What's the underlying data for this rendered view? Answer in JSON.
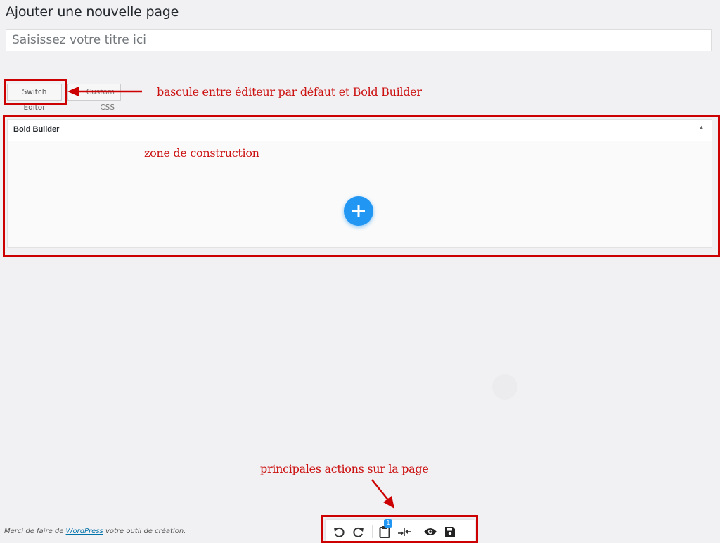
{
  "page": {
    "heading": "Ajouter une nouvelle page",
    "title_placeholder": "Saisissez votre titre ici"
  },
  "buttons": {
    "switch_editor": "Switch Editor",
    "custom_css": "Custom CSS"
  },
  "builder": {
    "title": "Bold Builder",
    "toggle_glyph": "▲"
  },
  "toolbar": {
    "clipboard_count": "1",
    "icons": [
      "undo-icon",
      "redo-icon",
      "clipboard-icon",
      "split-arrows-icon",
      "preview-eye-icon",
      "save-icon"
    ]
  },
  "footer": {
    "prefix": "Merci de faire de ",
    "link": "WordPress",
    "suffix": " votre outil de création."
  },
  "annotations": {
    "switch": "bascule entre éditeur par défaut et Bold Builder",
    "zone": "zone de construction",
    "actions": "principales actions sur la page"
  },
  "colors": {
    "annotation_red": "#cc0000",
    "accent_blue": "#2196f3",
    "link_blue": "#0073aa"
  }
}
